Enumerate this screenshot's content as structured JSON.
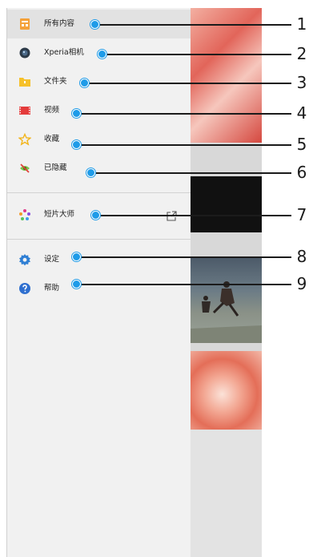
{
  "drawer": {
    "items": [
      {
        "label": "所有内容",
        "icon": "all-content-icon",
        "selected": true
      },
      {
        "label": "Xperia相机",
        "icon": "camera-lens-icon"
      },
      {
        "label": "文件夹",
        "icon": "folder-icon"
      },
      {
        "label": "视频",
        "icon": "film-icon"
      },
      {
        "label": "收藏",
        "icon": "star-icon"
      },
      {
        "label": "已隐藏",
        "icon": "hidden-icon"
      },
      {
        "label": "短片大师",
        "icon": "movie-creator-icon"
      },
      {
        "label": "设定",
        "icon": "gear-icon"
      },
      {
        "label": "帮助",
        "icon": "help-icon"
      }
    ]
  },
  "callouts": [
    "1",
    "2",
    "3",
    "4",
    "5",
    "6",
    "7",
    "8",
    "9"
  ],
  "colors": {
    "accent": "#1e9be8",
    "drawer_bg": "#f1f1f1",
    "selected_bg": "#e2e2e2"
  }
}
